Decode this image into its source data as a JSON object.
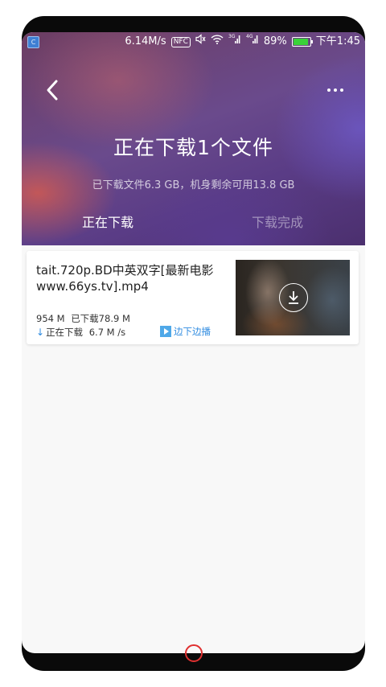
{
  "status_bar": {
    "app_icon_letter": "C",
    "speed": "6.14M/s",
    "nfc": "NFC",
    "network_3g": "3G",
    "network_4g": "4G",
    "battery": "89%",
    "battery_level": 0.89,
    "time": "下午1:45"
  },
  "header": {
    "title": "正在下载1个文件",
    "subtitle": "已下载文件6.3 GB，机身剩余可用13.8 GB",
    "tabs": [
      {
        "label": "正在下载",
        "active": true
      },
      {
        "label": "下载完成",
        "active": false
      }
    ]
  },
  "download_item": {
    "file_name": "tait.720p.BD中英双字[最新电影www.66ys.tv].mp4",
    "size": "954 M",
    "downloaded": "已下载78.9 M",
    "status": "正在下载",
    "speed": "6.7 M /s",
    "play_while_downloading": "边下边播"
  },
  "colors": {
    "accent": "#2f8be0",
    "home_button": "#e03030",
    "battery": "#3ad13a"
  }
}
